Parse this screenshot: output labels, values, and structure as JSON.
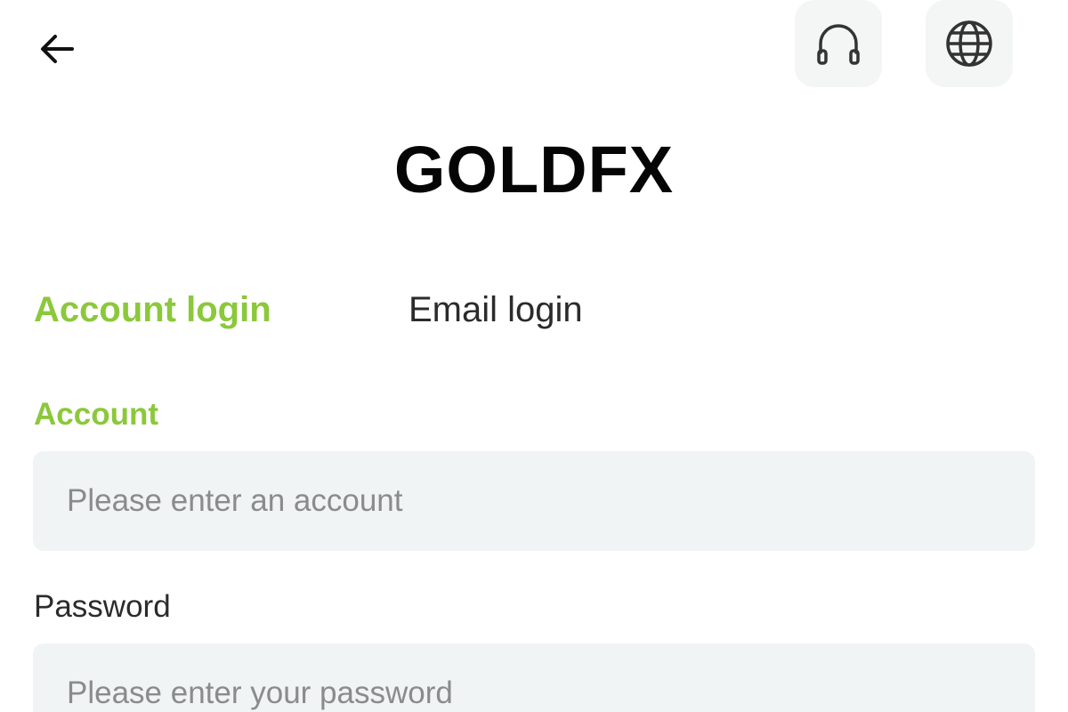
{
  "header": {
    "back_icon": "arrow-left-icon",
    "support_icon": "headset-icon",
    "language_icon": "globe-icon"
  },
  "brand": {
    "logo_text": "GOLDFX"
  },
  "tabs": [
    {
      "label": "Account login",
      "active": true
    },
    {
      "label": "Email login",
      "active": false
    }
  ],
  "form": {
    "account": {
      "label": "Account",
      "placeholder": "Please enter an account",
      "value": ""
    },
    "password": {
      "label": "Password",
      "placeholder": "Please enter your password",
      "value": ""
    }
  },
  "colors": {
    "accent": "#8bc83b",
    "input_bg": "#f1f4f4",
    "icon_button_bg": "#f4f5f5",
    "text": "#2b2b2b",
    "placeholder": "#8a8c8c"
  }
}
